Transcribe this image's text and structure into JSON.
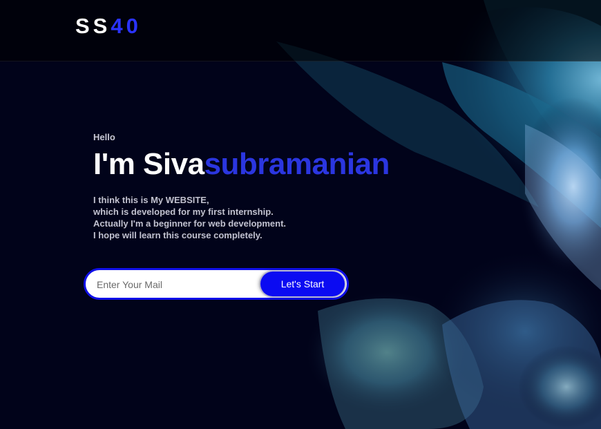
{
  "header": {
    "logo_letters_white": "SS",
    "logo_digits_blue": "40"
  },
  "hero": {
    "greeting": "Hello",
    "headline_white": "I'm Siva",
    "headline_blue": "subramanian",
    "description_lines": [
      "I think this is My WEBSITE,",
      "which is developed for my first internship.",
      "Actually I'm a beginner for web development.",
      "I hope will learn this course completely."
    ]
  },
  "signup_form": {
    "email_placeholder": "Enter Your Mail",
    "email_value": "",
    "button_label": "Let's Start"
  },
  "colors": {
    "background": "#01031a",
    "accent_blue": "#0b0bf2",
    "headline_blue": "#2b36e0",
    "logo_blue": "#2a33ff"
  },
  "icons": {
    "background_art": "abstract-particle-splash-image"
  }
}
